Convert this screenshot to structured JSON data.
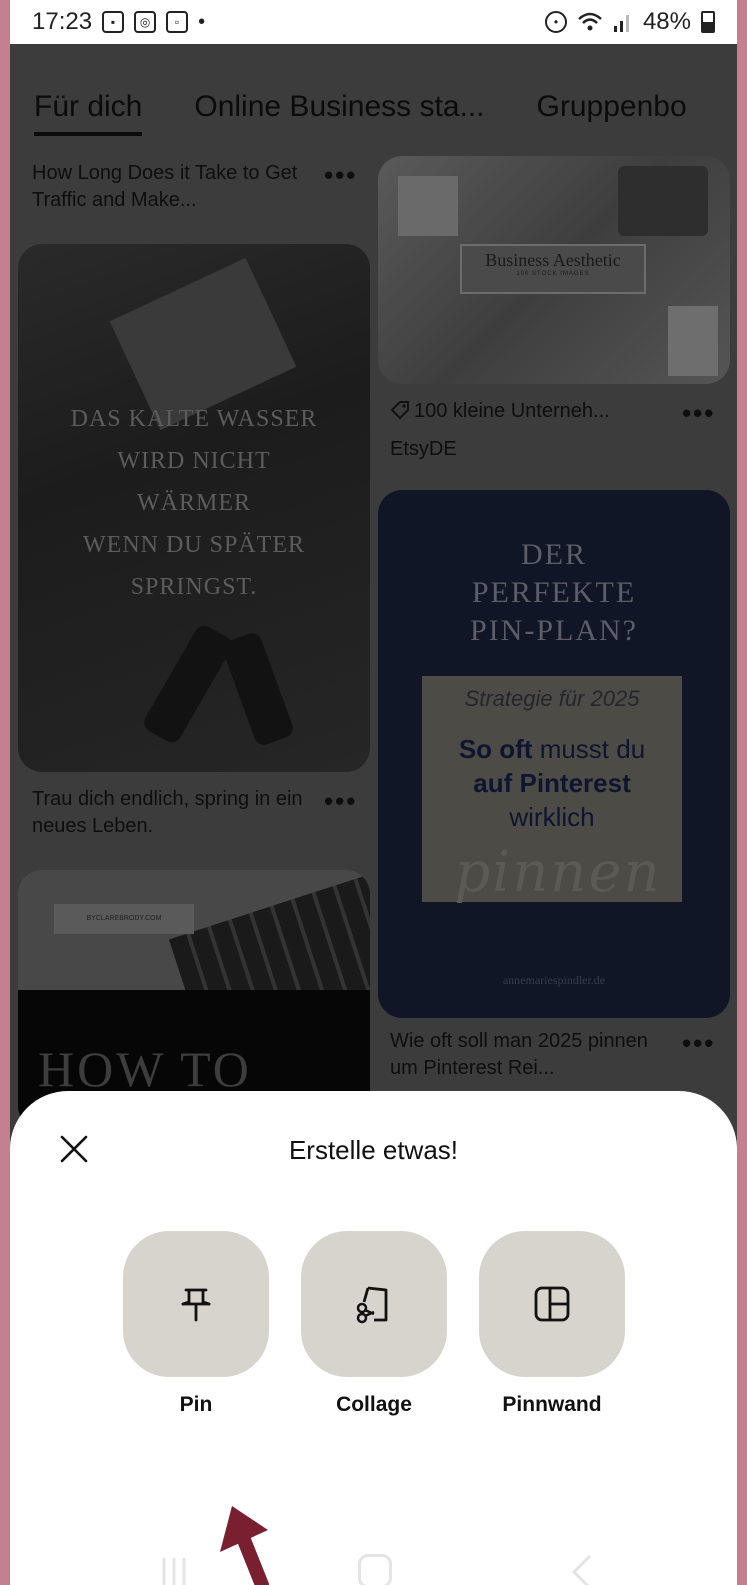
{
  "status_bar": {
    "time": "17:23",
    "icons_left": [
      "gallery-icon",
      "instagram-icon",
      "screen-record-icon"
    ],
    "dot": "•",
    "icons_right": [
      "data-saver-icon",
      "wifi-icon",
      "signal-icon",
      "battery-icon"
    ],
    "battery": "48%"
  },
  "tabs": [
    {
      "label": "Für dich",
      "active": true
    },
    {
      "label": "Online Business sta..."
    },
    {
      "label": "Gruppenbo"
    }
  ],
  "feed": {
    "pin1_caption": "How Long Does it Take to Get Traffic and Make...",
    "pin2_image_text": "Business Aesthetic",
    "pin2_image_subtext": "100 STOCK IMAGES",
    "pin2_caption": "100 kleine Unterneh...",
    "pin2_source": "EtsyDE",
    "pin3_quote_lines": [
      "DAS KALTE WASSER",
      "WIRD NICHT",
      "WÄRMER",
      "WENN DU SPÄTER",
      "SPRINGST."
    ],
    "pin3_caption": "Trau dich endlich, spring in ein neues Leben.",
    "pin4_heading_lines": [
      "DER",
      "PERFEKTE",
      "PIN-PLAN?"
    ],
    "pin4_strategy": "Strategie für 2025",
    "pin4_body_line1_bold": "So oft",
    "pin4_body_line1_rest": " musst du",
    "pin4_body_line2": "auf Pinterest",
    "pin4_body_line3": "wirklich",
    "pin4_script": "pinnen",
    "pin4_site": "annemariespindler.de",
    "pin4_caption": "Wie oft soll man 2025 pinnen um Pinterest Rei...",
    "pin5_tag": "BYCLAREBRODY.COM",
    "pin5_heading": "HOW TO",
    "more_label": "•••"
  },
  "sheet": {
    "title": "Erstelle etwas!",
    "options": [
      {
        "label": "Pin",
        "icon": "pushpin-icon"
      },
      {
        "label": "Collage",
        "icon": "scissors-collage-icon"
      },
      {
        "label": "Pinnwand",
        "icon": "board-layout-icon"
      }
    ]
  },
  "colors": {
    "frame": "#c4808f",
    "sheet_bg": "#ffffff",
    "option_bg": "#d6d4cc",
    "arrow": "#7a1f30"
  }
}
